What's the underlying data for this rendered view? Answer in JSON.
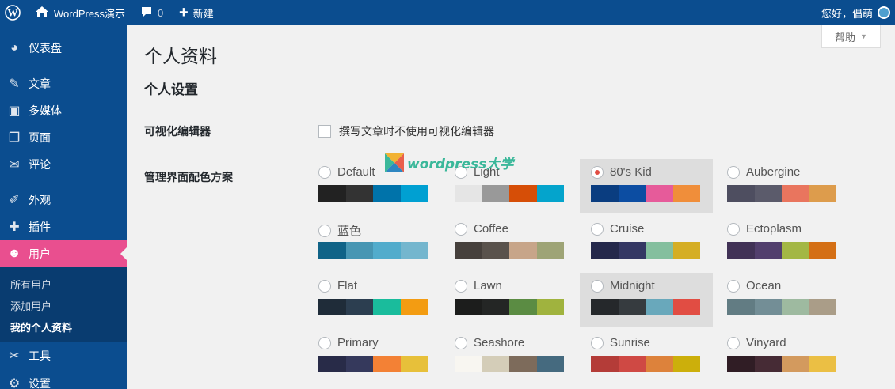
{
  "admin_bar": {
    "site_name": "WordPress演示",
    "comments_count": "0",
    "new_label": "新建",
    "howdy": "您好，倡萌"
  },
  "sidebar": {
    "items": [
      {
        "label": "仪表盘",
        "icon": "dashboard-icon",
        "glyph": "◕"
      },
      {
        "label": "文章",
        "icon": "pin-icon",
        "glyph": "✎"
      },
      {
        "label": "多媒体",
        "icon": "media-icon",
        "glyph": "▣"
      },
      {
        "label": "页面",
        "icon": "page-icon",
        "glyph": "❐"
      },
      {
        "label": "评论",
        "icon": "comment-icon",
        "glyph": "✉"
      },
      {
        "label": "外观",
        "icon": "brush-icon",
        "glyph": "✐"
      },
      {
        "label": "插件",
        "icon": "plugin-icon",
        "glyph": "✚"
      },
      {
        "label": "用户",
        "icon": "users-icon",
        "glyph": "☻"
      },
      {
        "label": "工具",
        "icon": "wrench-icon",
        "glyph": "✂"
      },
      {
        "label": "设置",
        "icon": "settings-icon",
        "glyph": "⚙"
      }
    ],
    "submenu": [
      "所有用户",
      "添加用户",
      "我的个人资料"
    ]
  },
  "help_tab": "帮助",
  "page_title": "个人资料",
  "section_title": "个人设置",
  "visual_editor": {
    "label": "可视化编辑器",
    "option": "撰写文章时不使用可视化编辑器"
  },
  "color_scheme": {
    "label": "管理界面配色方案",
    "selected": "80's Kid",
    "schemes": [
      {
        "name": "Default",
        "colors": [
          "#222222",
          "#333333",
          "#0073aa",
          "#00a0d2"
        ]
      },
      {
        "name": "Light",
        "colors": [
          "#e5e5e5",
          "#999999",
          "#d64e07",
          "#04a4cc"
        ]
      },
      {
        "name": "80's Kid",
        "colors": [
          "#0a3d80",
          "#0c4da2",
          "#e65b9a",
          "#f08e3a"
        ]
      },
      {
        "name": "Aubergine",
        "colors": [
          "#4e4e60",
          "#5b5b6b",
          "#e9755e",
          "#dd9c4c"
        ]
      },
      {
        "name": "蓝色",
        "colors": [
          "#106387",
          "#4796b3",
          "#52accc",
          "#74b6ce"
        ]
      },
      {
        "name": "Coffee",
        "colors": [
          "#46403c",
          "#59524c",
          "#c7a589",
          "#9ea476"
        ]
      },
      {
        "name": "Cruise",
        "colors": [
          "#24284b",
          "#343763",
          "#84bf9e",
          "#d5ae24"
        ]
      },
      {
        "name": "Ectoplasm",
        "colors": [
          "#413256",
          "#523f6d",
          "#a3b745",
          "#d46f15"
        ]
      },
      {
        "name": "Flat",
        "colors": [
          "#1f2c39",
          "#2c3e50",
          "#1abc9c",
          "#f39c12"
        ]
      },
      {
        "name": "Lawn",
        "colors": [
          "#1c1d1c",
          "#242625",
          "#5b8c43",
          "#a0b33e"
        ]
      },
      {
        "name": "Midnight",
        "colors": [
          "#25282b",
          "#363b3f",
          "#69a8bb",
          "#e14d43"
        ]
      },
      {
        "name": "Ocean",
        "colors": [
          "#627c83",
          "#738e96",
          "#9ebaa0",
          "#aa9d88"
        ]
      },
      {
        "name": "Primary",
        "colors": [
          "#282b48",
          "#35395c",
          "#f38135",
          "#e7c03a"
        ]
      },
      {
        "name": "Seashore",
        "colors": [
          "#f8f6f1",
          "#d4cdb8",
          "#7d6b5b",
          "#456a7f"
        ]
      },
      {
        "name": "Sunrise",
        "colors": [
          "#b43c38",
          "#cf4944",
          "#dd823b",
          "#ccaf0b"
        ]
      },
      {
        "name": "Vinyard",
        "colors": [
          "#301d25",
          "#462b35",
          "#d39a5e",
          "#ebbf44"
        ]
      }
    ]
  },
  "watermark": "wordpress大学"
}
